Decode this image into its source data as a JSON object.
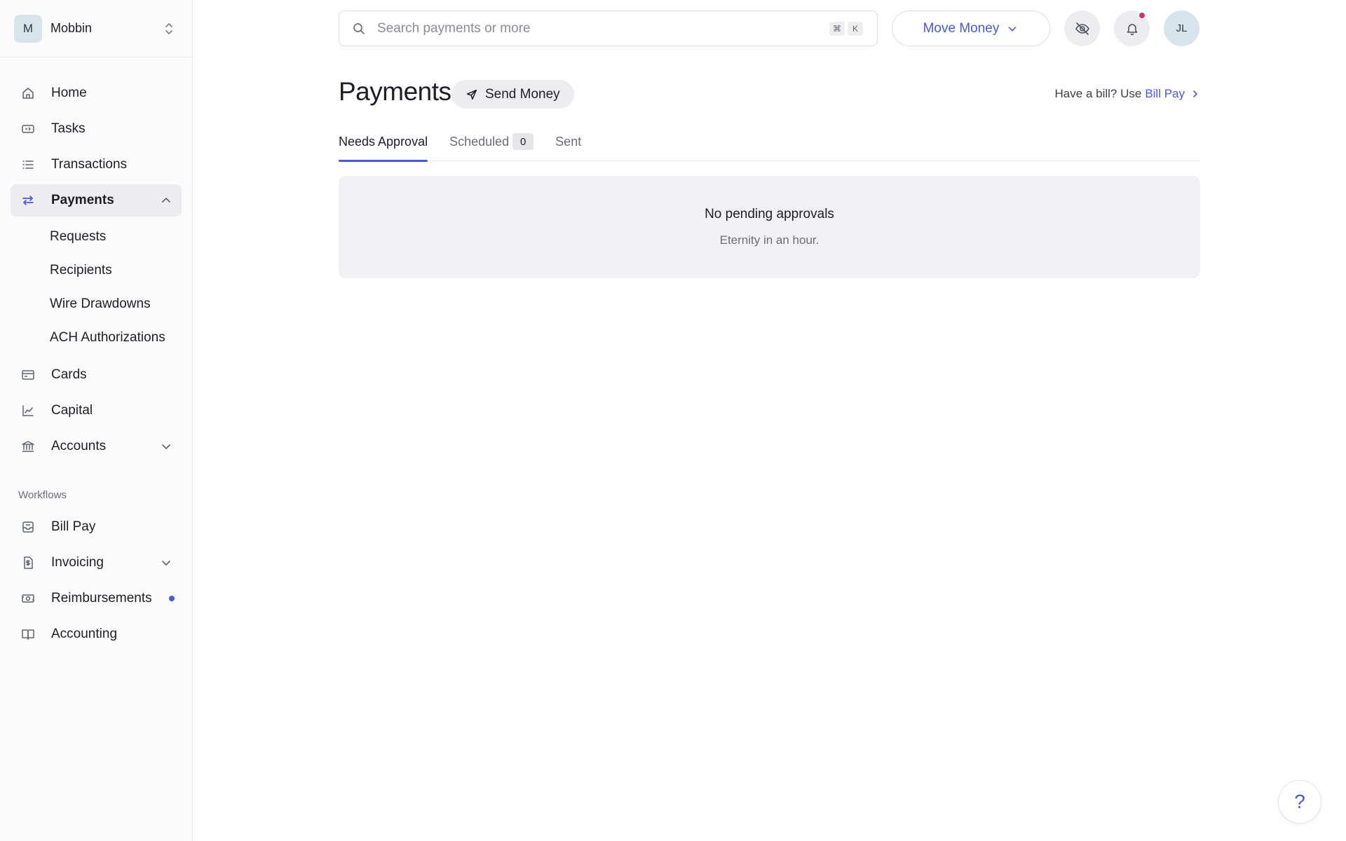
{
  "org": {
    "initial": "M",
    "name": "Mobbin"
  },
  "sidebar": {
    "items": [
      {
        "label": "Home",
        "icon": "home-icon"
      },
      {
        "label": "Tasks",
        "icon": "tasks-icon"
      },
      {
        "label": "Transactions",
        "icon": "list-icon"
      },
      {
        "label": "Payments",
        "icon": "arrows-swap-icon",
        "active": true,
        "expanded": true,
        "children": [
          "Requests",
          "Recipients",
          "Wire Drawdowns",
          "ACH Authorizations"
        ]
      },
      {
        "label": "Cards",
        "icon": "card-icon"
      },
      {
        "label": "Capital",
        "icon": "chart-line-icon"
      },
      {
        "label": "Accounts",
        "icon": "bank-icon",
        "expandable": true
      }
    ],
    "workflows_label": "Workflows",
    "workflows": [
      {
        "label": "Bill Pay",
        "icon": "bill-icon"
      },
      {
        "label": "Invoicing",
        "icon": "invoice-icon",
        "expandable": true
      },
      {
        "label": "Reimbursements",
        "icon": "cash-icon",
        "indicator": true
      },
      {
        "label": "Accounting",
        "icon": "book-icon"
      }
    ]
  },
  "topbar": {
    "search_placeholder": "Search payments or more",
    "shortcut_keys": [
      "⌘",
      "K"
    ],
    "move_money_label": "Move Money",
    "user_initials": "JL",
    "has_notification": true
  },
  "page": {
    "title": "Payments",
    "send_money_label": "Send Money",
    "bill_hint_prefix": "Have a bill? Use",
    "bill_hint_link": "Bill Pay"
  },
  "tabs": [
    {
      "label": "Needs Approval",
      "active": true
    },
    {
      "label": "Scheduled",
      "count": "0"
    },
    {
      "label": "Sent"
    }
  ],
  "empty_state": {
    "title": "No pending approvals",
    "subtitle": "Eternity in an hour."
  },
  "help_label": "?",
  "colors": {
    "accent": "#4a59d6",
    "notification": "#d6336c",
    "sidebar_bg": "#fbfbfc",
    "panel_bg": "#f1f1f3"
  }
}
